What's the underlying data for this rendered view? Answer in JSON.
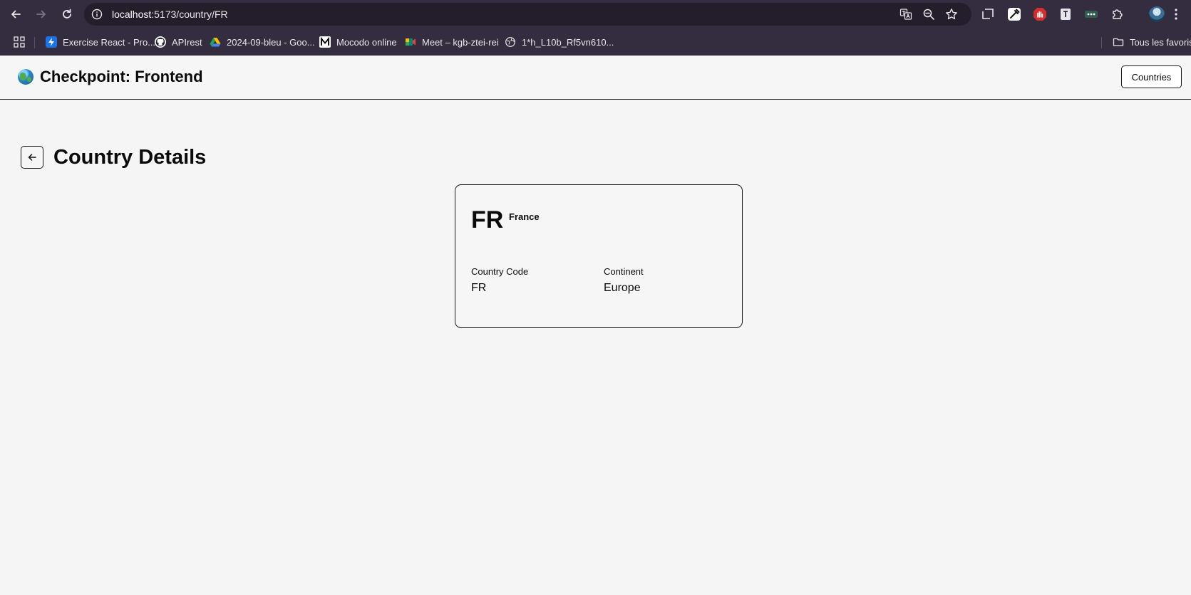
{
  "browser": {
    "url_host": "localhost",
    "url_path": ":5173/country/FR",
    "bookmarks": [
      {
        "label": "Exercise React - Pro...",
        "icon": "bolt-icon",
        "color": "#1a73e8"
      },
      {
        "label": "APIrest",
        "icon": "github-icon",
        "color": "#ffffff"
      },
      {
        "label": "2024-09-bleu - Goo...",
        "icon": "google-drive-icon",
        "color": "#1fa463"
      },
      {
        "label": "Mocodo online",
        "icon": "mocodo-icon",
        "color": "#ffffff"
      },
      {
        "label": "Meet – kgb-ztei-rei",
        "icon": "google-meet-icon",
        "color": "#00897b"
      },
      {
        "label": "1*h_L10b_Rf5vn610...",
        "icon": "globe-icon",
        "color": "#cfcfcf"
      }
    ],
    "all_bookmarks_label": "Tous les favoris"
  },
  "header": {
    "brand_title": "Checkpoint: Frontend",
    "countries_button": "Countries"
  },
  "page": {
    "title": "Country Details"
  },
  "country": {
    "code": "FR",
    "name": "France",
    "code_label": "Country Code",
    "code_value": "FR",
    "continent_label": "Continent",
    "continent_value": "Europe"
  }
}
